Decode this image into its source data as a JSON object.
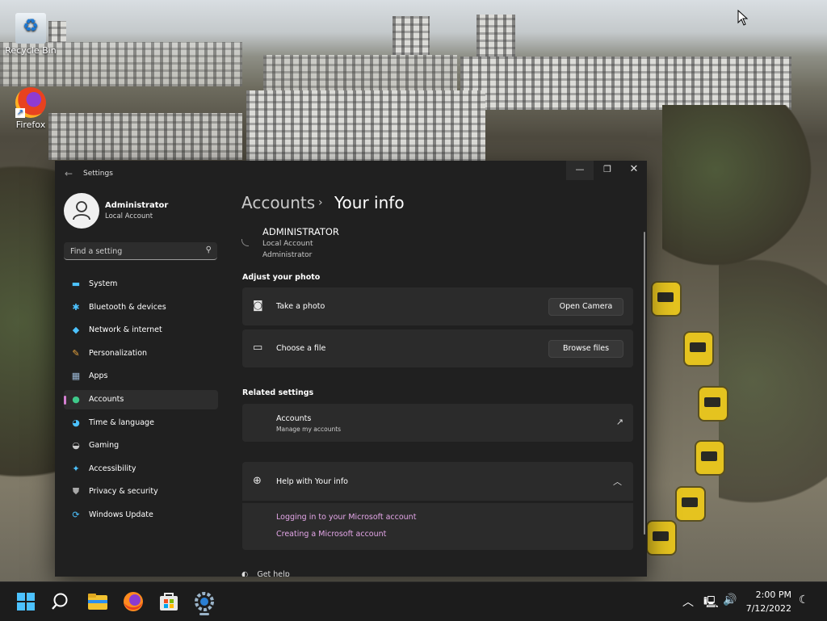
{
  "desktop": {
    "icons": [
      {
        "label": "Recycle Bin",
        "icon": "recycle-bin-icon"
      },
      {
        "label": "Firefox",
        "icon": "firefox-icon"
      }
    ]
  },
  "window": {
    "title": "Settings",
    "controls": {
      "minimize": "—",
      "maximize": "❐",
      "close": "✕"
    }
  },
  "sidebar": {
    "profile": {
      "name": "Administrator",
      "account_type": "Local Account"
    },
    "search": {
      "placeholder": "Find a setting"
    },
    "items": [
      {
        "label": "System",
        "icon": "system-icon",
        "color": "#4cc2ff",
        "glyph": "▬"
      },
      {
        "label": "Bluetooth & devices",
        "icon": "bluetooth-icon",
        "color": "#4cc2ff",
        "glyph": "✱"
      },
      {
        "label": "Network & internet",
        "icon": "network-icon",
        "color": "#4cc2ff",
        "glyph": "◆"
      },
      {
        "label": "Personalization",
        "icon": "brush-icon",
        "color": "#e8a33d",
        "glyph": "✎"
      },
      {
        "label": "Apps",
        "icon": "apps-icon",
        "color": "#9bb7d4",
        "glyph": "▦"
      },
      {
        "label": "Accounts",
        "icon": "accounts-icon",
        "color": "#3fc98a",
        "glyph": "●",
        "active": true
      },
      {
        "label": "Time & language",
        "icon": "globe-clock-icon",
        "color": "#4cc2ff",
        "glyph": "◕"
      },
      {
        "label": "Gaming",
        "icon": "gamepad-icon",
        "color": "#c8c8c8",
        "glyph": "◒"
      },
      {
        "label": "Accessibility",
        "icon": "accessibility-icon",
        "color": "#4cc2ff",
        "glyph": "✦"
      },
      {
        "label": "Privacy & security",
        "icon": "shield-icon",
        "color": "#a8a8a8",
        "glyph": "⛊"
      },
      {
        "label": "Windows Update",
        "icon": "windows-update-icon",
        "color": "#4cc2ff",
        "glyph": "⟳"
      }
    ]
  },
  "main": {
    "breadcrumb": {
      "parent": "Accounts",
      "separator": "›",
      "current": "Your info"
    },
    "user": {
      "name": "ADMINISTRATOR",
      "account_type": "Local Account",
      "role": "Administrator"
    },
    "adjust_photo": {
      "heading": "Adjust your photo",
      "take_photo": {
        "label": "Take a photo",
        "button": "Open Camera"
      },
      "choose_file": {
        "label": "Choose a file",
        "button": "Browse files"
      }
    },
    "related": {
      "heading": "Related settings",
      "accounts": {
        "label": "Accounts",
        "sub": "Manage my accounts"
      }
    },
    "help": {
      "title": "Help with Your info",
      "links": [
        "Logging in to your Microsoft account",
        "Creating a Microsoft account"
      ]
    },
    "get_help": "Get help"
  },
  "taskbar": {
    "apps": [
      "start-icon",
      "search-icon",
      "file-explorer-icon",
      "firefox-icon",
      "store-icon",
      "settings-icon"
    ],
    "clock": {
      "time": "2:00 PM",
      "date": "7/12/2022"
    }
  },
  "colors": {
    "accent_link": "#e4a6e8",
    "active_indicator": "#d47fd1",
    "window_bg": "#202020",
    "card_bg": "#2b2b2b"
  }
}
